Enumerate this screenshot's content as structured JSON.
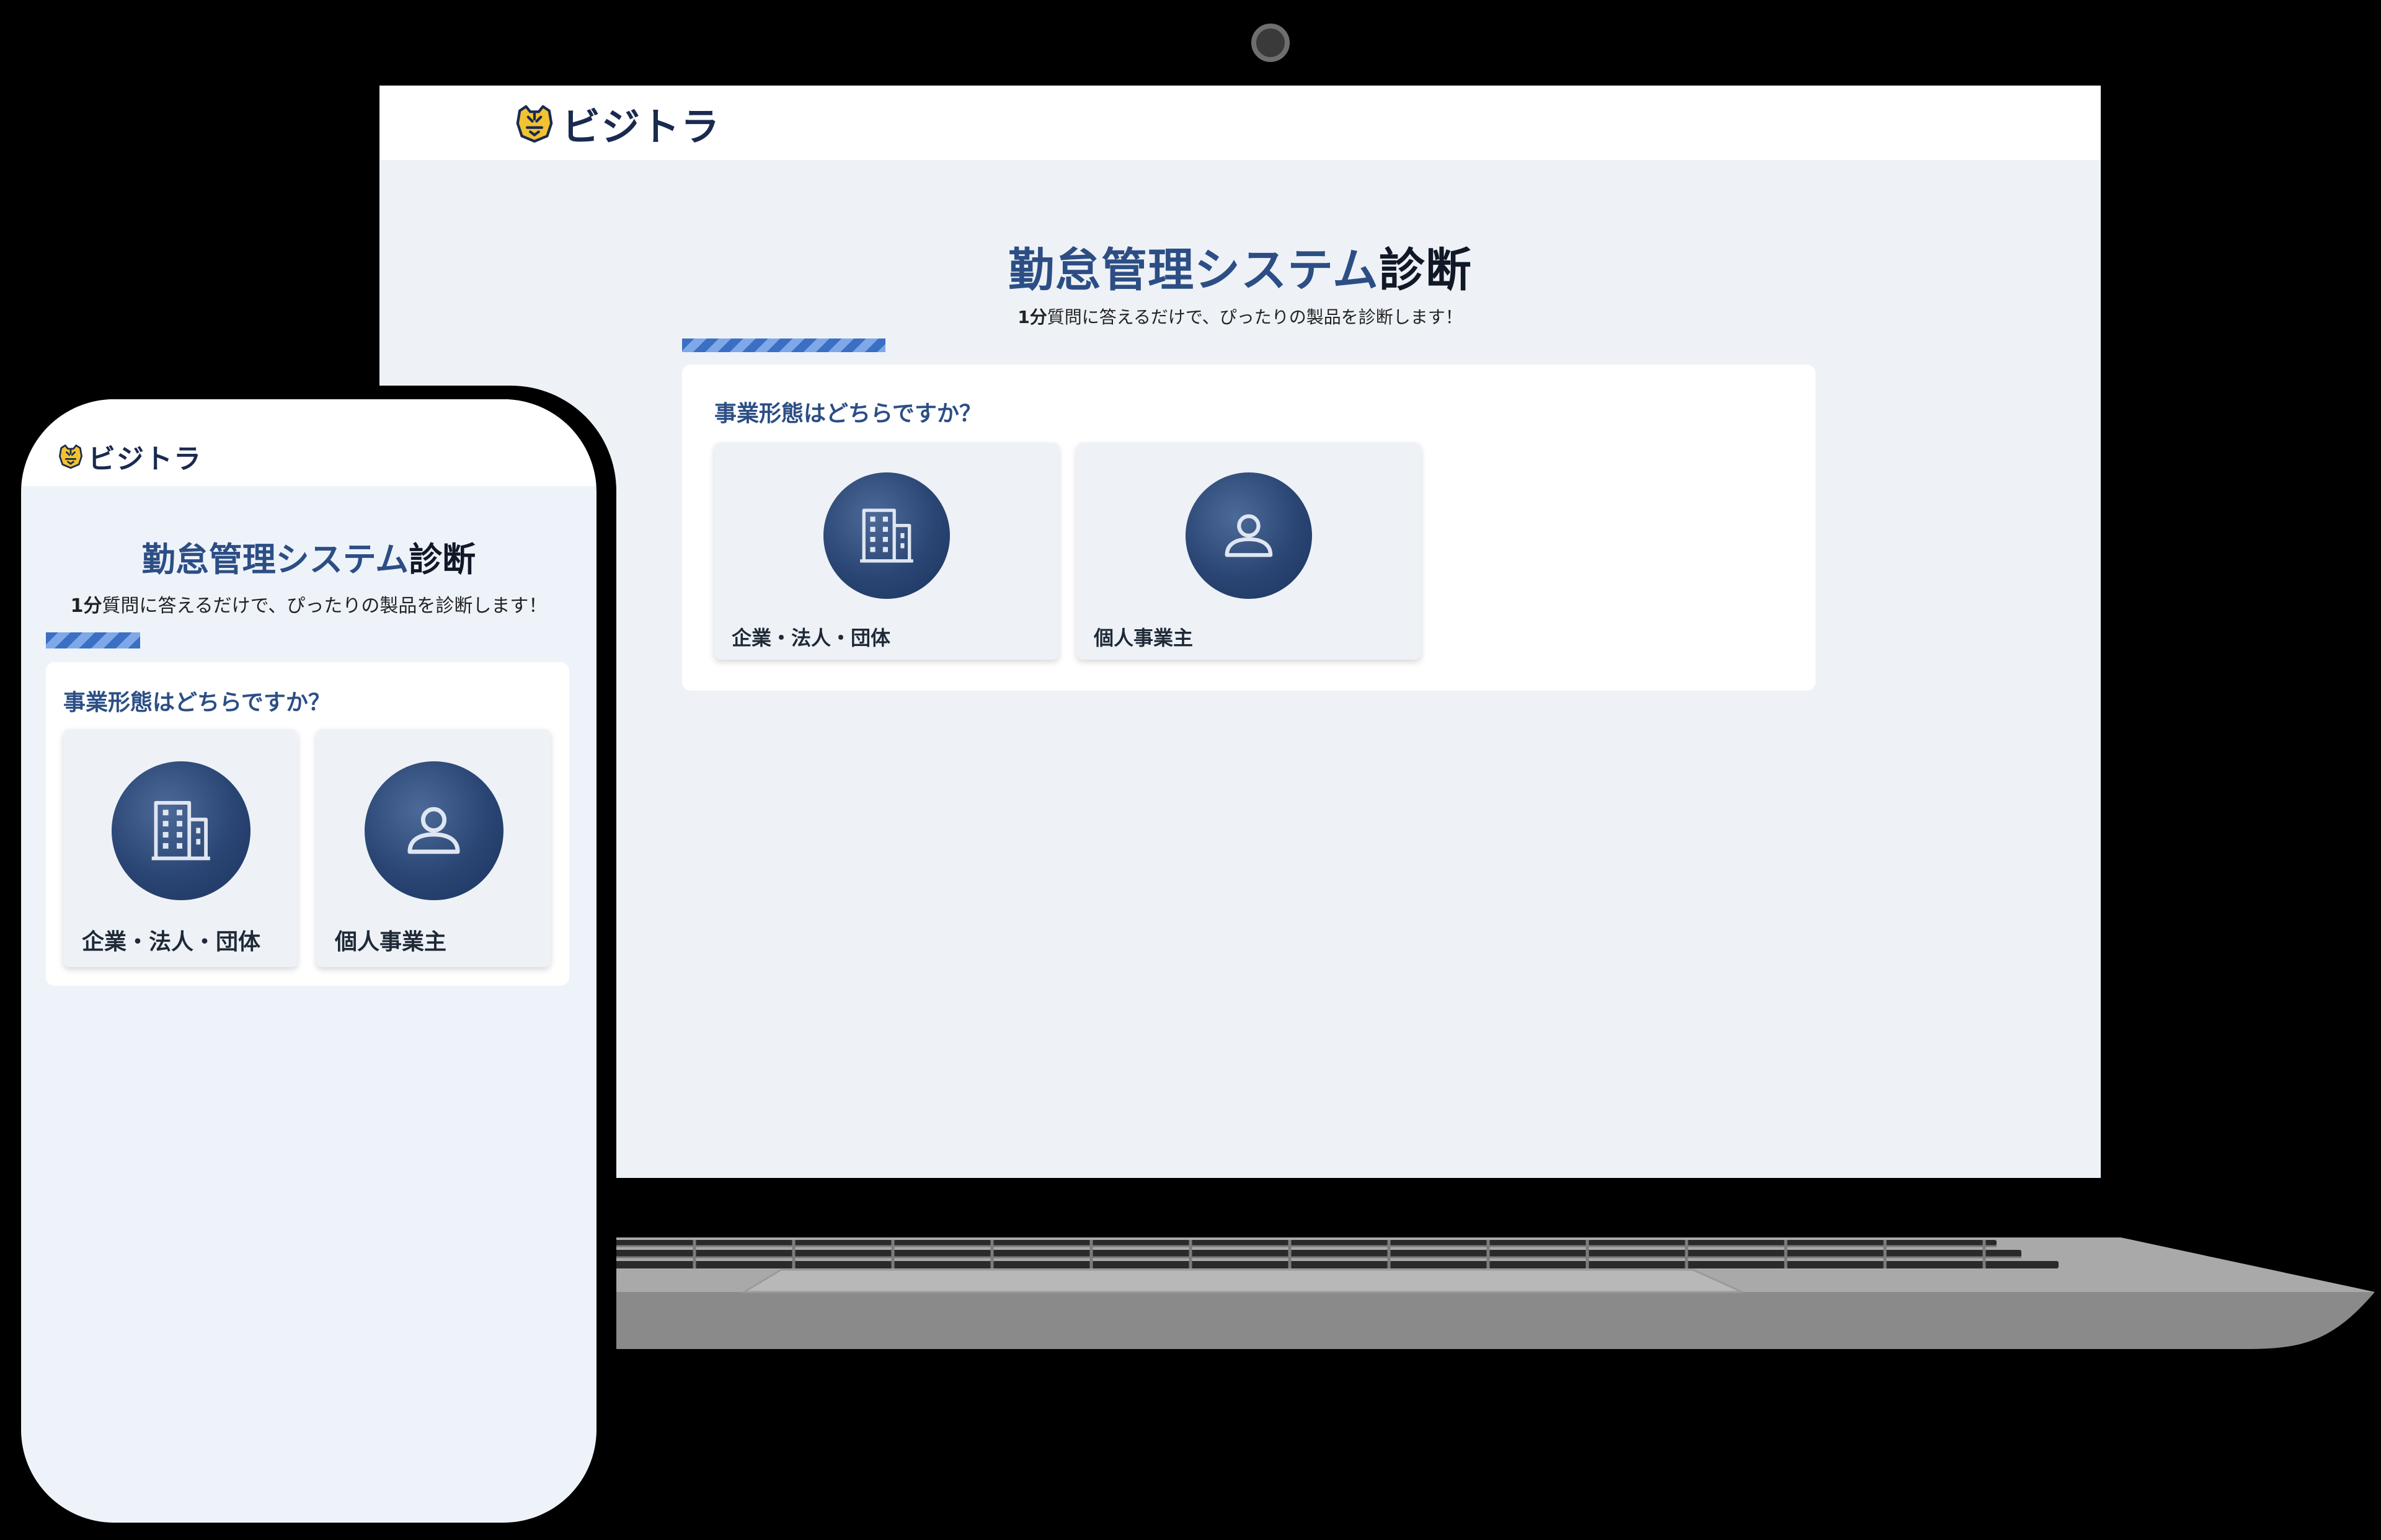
{
  "brand": {
    "name": "ビジトラ",
    "logo_icon": "tiger-head-icon",
    "logo_color": "#f2c230"
  },
  "page": {
    "title_part1": "勤怠管理システム",
    "title_part2": "診断",
    "subtitle_bold": "1分",
    "subtitle_rest": "質問に答えるだけで、ぴったりの製品を診断します！"
  },
  "question": {
    "text": "事業形態はどちらですか？",
    "options": [
      {
        "label": "企業・法人・団体",
        "icon": "building-icon"
      },
      {
        "label": "個人事業主",
        "icon": "person-icon"
      }
    ]
  },
  "colors": {
    "title": "#2c4e85",
    "accent": "#3a6fc4",
    "page_bg": "#eef2f6",
    "icon_circle": "#2a4573"
  }
}
